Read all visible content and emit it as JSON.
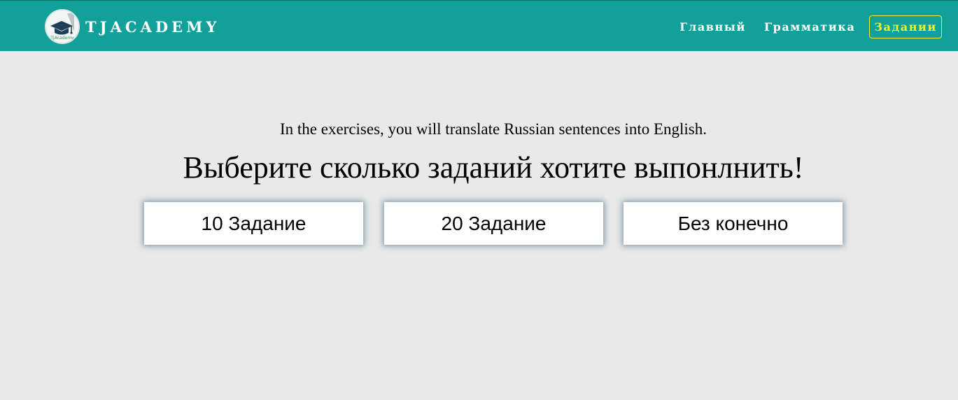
{
  "brand": {
    "name": "TJACADEMY",
    "logo_icon": "graduation-cap-icon",
    "logo_caption": "TjAcademy"
  },
  "nav": {
    "items": [
      {
        "label": "Главный",
        "active": false
      },
      {
        "label": "Грамматика",
        "active": false
      },
      {
        "label": "Задании",
        "active": true
      }
    ]
  },
  "main": {
    "intro": "In the exercises, you will translate Russian sentences into English.",
    "headline": "Выберите сколько заданий хотите выпонлнить!",
    "choices": [
      {
        "label": "10 Задание"
      },
      {
        "label": "20 Задание"
      },
      {
        "label": "Без конечно"
      }
    ]
  },
  "colors": {
    "navbar": "#12a19a",
    "active_nav": "#f2f224",
    "background": "#e9e9e9",
    "button_shadow": "#2f5f73"
  }
}
